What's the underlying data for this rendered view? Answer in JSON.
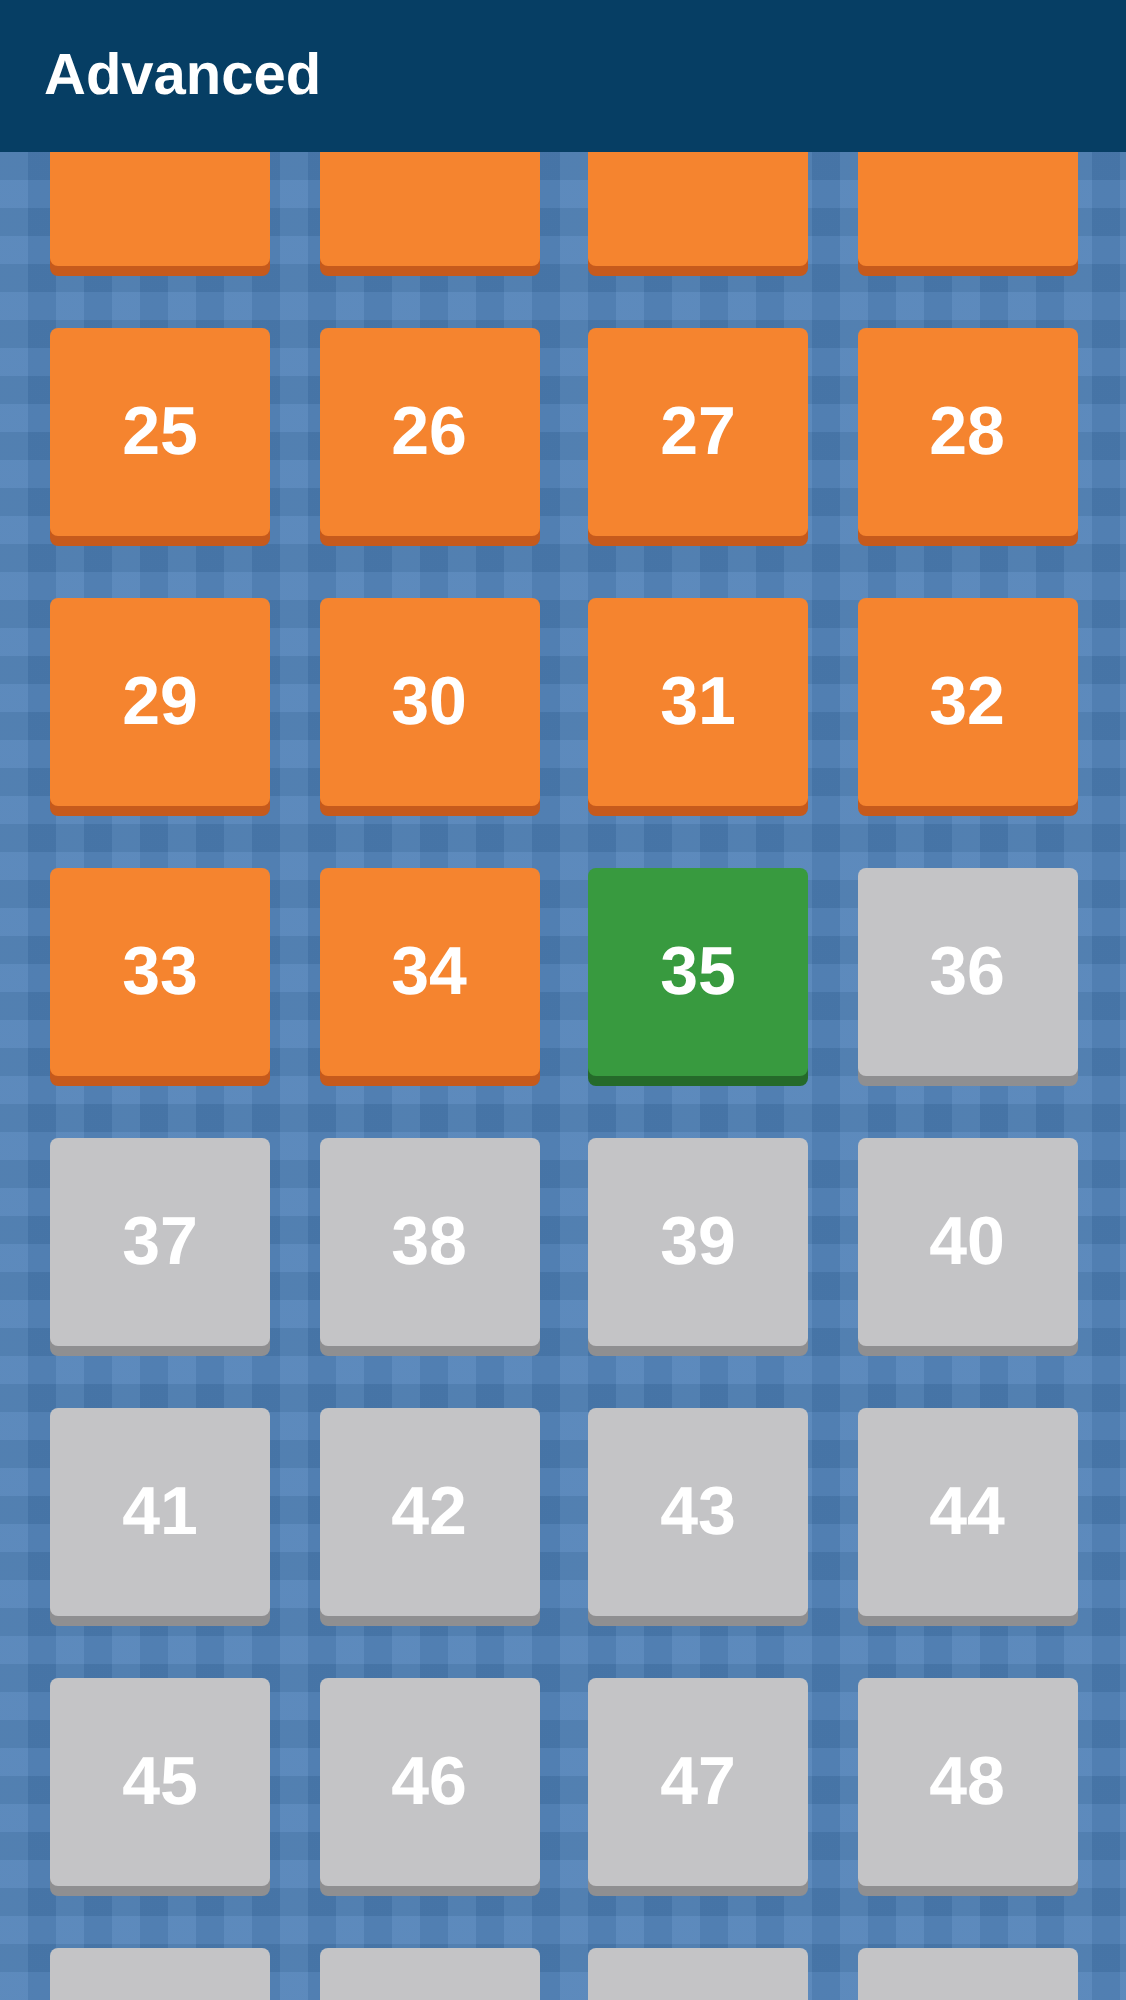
{
  "header": {
    "title": "Advanced"
  },
  "levels": [
    {
      "locked": false,
      "selected": false
    },
    {
      "locked": false,
      "selected": false
    },
    {
      "locked": false,
      "selected": false
    },
    {
      "locked": false,
      "selected": false
    },
    {
      "number": "25",
      "locked": false,
      "selected": false
    },
    {
      "number": "26",
      "locked": false,
      "selected": false
    },
    {
      "number": "27",
      "locked": false,
      "selected": false
    },
    {
      "number": "28",
      "locked": false,
      "selected": false
    },
    {
      "number": "29",
      "locked": false,
      "selected": false
    },
    {
      "number": "30",
      "locked": false,
      "selected": false
    },
    {
      "number": "31",
      "locked": false,
      "selected": false
    },
    {
      "number": "32",
      "locked": false,
      "selected": false
    },
    {
      "number": "33",
      "locked": false,
      "selected": false
    },
    {
      "number": "34",
      "locked": false,
      "selected": false
    },
    {
      "number": "35",
      "locked": false,
      "selected": true
    },
    {
      "number": "36",
      "locked": true,
      "selected": false
    },
    {
      "number": "37",
      "locked": true,
      "selected": false
    },
    {
      "number": "38",
      "locked": true,
      "selected": false
    },
    {
      "number": "39",
      "locked": true,
      "selected": false
    },
    {
      "number": "40",
      "locked": true,
      "selected": false
    },
    {
      "number": "41",
      "locked": true,
      "selected": false
    },
    {
      "number": "42",
      "locked": true,
      "selected": false
    },
    {
      "number": "43",
      "locked": true,
      "selected": false
    },
    {
      "number": "44",
      "locked": true,
      "selected": false
    },
    {
      "number": "45",
      "locked": true,
      "selected": false
    },
    {
      "number": "46",
      "locked": true,
      "selected": false
    },
    {
      "number": "47",
      "locked": true,
      "selected": false
    },
    {
      "number": "48",
      "locked": true,
      "selected": false
    },
    {
      "locked": true,
      "selected": false
    },
    {
      "locked": true,
      "selected": false
    },
    {
      "locked": true,
      "selected": false
    },
    {
      "locked": true,
      "selected": false
    }
  ]
}
